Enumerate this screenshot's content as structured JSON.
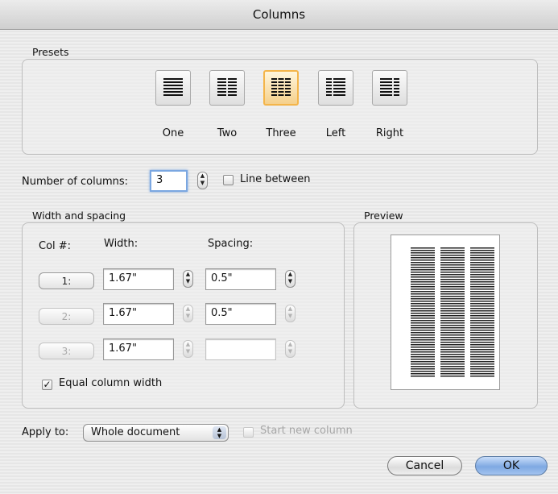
{
  "window": {
    "title": "Columns"
  },
  "presets": {
    "group_label": "Presets",
    "items": [
      {
        "label": "One",
        "selected": false
      },
      {
        "label": "Two",
        "selected": false
      },
      {
        "label": "Three",
        "selected": true
      },
      {
        "label": "Left",
        "selected": false
      },
      {
        "label": "Right",
        "selected": false
      }
    ]
  },
  "number_of_columns": {
    "label": "Number of columns:",
    "value": "3"
  },
  "line_between": {
    "label": "Line between",
    "checked": false
  },
  "width_spacing": {
    "group_label": "Width and spacing",
    "col_header": "Col #:",
    "width_header": "Width:",
    "spacing_header": "Spacing:",
    "rows": [
      {
        "col": "1:",
        "width": "1.67\"",
        "spacing": "0.5\"",
        "enabled": true
      },
      {
        "col": "2:",
        "width": "1.67\"",
        "spacing": "0.5\"",
        "enabled": false
      },
      {
        "col": "3:",
        "width": "1.67\"",
        "spacing": "",
        "enabled": false
      }
    ],
    "equal_width": {
      "label": "Equal column width",
      "checked": true
    }
  },
  "preview": {
    "group_label": "Preview",
    "columns": 3
  },
  "apply_to": {
    "label": "Apply to:",
    "value": "Whole document"
  },
  "start_new_column": {
    "label": "Start new column",
    "checked": false,
    "enabled": false
  },
  "buttons": {
    "cancel": "Cancel",
    "ok": "OK"
  },
  "colors": {
    "selected_preset": "#f4b54a",
    "default_button": "#7fa9e2",
    "focus_ring": "#7ba7e1"
  }
}
